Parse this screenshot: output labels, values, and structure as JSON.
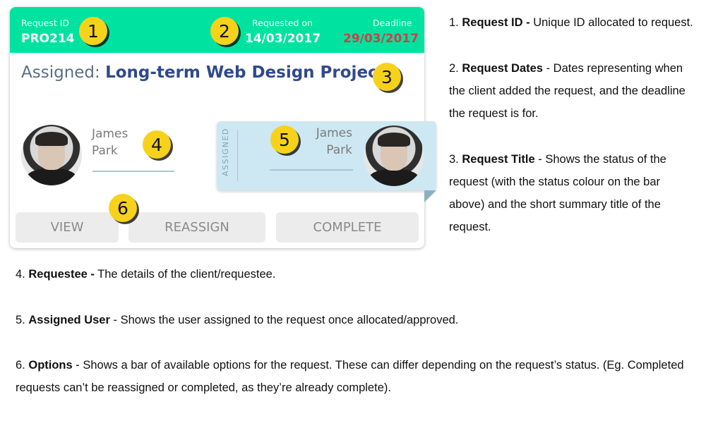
{
  "card": {
    "request_id_label": "Request ID",
    "request_id": "PRO214",
    "requested_on_label": "Requested on",
    "requested_on": "14/03/2017",
    "deadline_label": "Deadline",
    "deadline": "29/03/2017",
    "status": "Assigned:",
    "title": "Long-term Web Design Project",
    "requestee": {
      "first_name": "James",
      "last_name": "Park"
    },
    "assigned_label": "ASSIGNED",
    "assignee": {
      "first_name": "James",
      "last_name": "Park"
    },
    "options": [
      "VIEW",
      "REASSIGN",
      "COMPLETE"
    ]
  },
  "badges": [
    "1",
    "2",
    "3",
    "4",
    "5",
    "6"
  ],
  "notes": [
    {
      "num": "1.",
      "title": "Request ID -",
      "text": " Unique ID allocated to request."
    },
    {
      "num": "2.",
      "title": "Request Dates",
      "text": " - Dates representing when the client added the request, and the deadline the request is for."
    },
    {
      "num": "3.",
      "title": "Request Title",
      "text": " - Shows the status of the request (with the status colour on the bar above) and the short summary title of the request."
    },
    {
      "num": "4.",
      "title": "Requestee -",
      "text": " The details of the client/requestee."
    },
    {
      "num": "5.",
      "title": "Assigned User",
      "text": " - Shows the user assigned to the request once allocated/approved."
    },
    {
      "num": "6.",
      "title": "Options",
      "text": " - Shows a bar of available options for the request. These can differ depending on the request’s status. (Eg. Completed requests can’t be reassigned or completed, as they’re already complete)."
    }
  ],
  "colors": {
    "header": "#00e3a0",
    "deadline": "#c74347",
    "title": "#2f4a8c",
    "assigned_panel": "#cde8f3",
    "badge": "#f7d21b"
  }
}
